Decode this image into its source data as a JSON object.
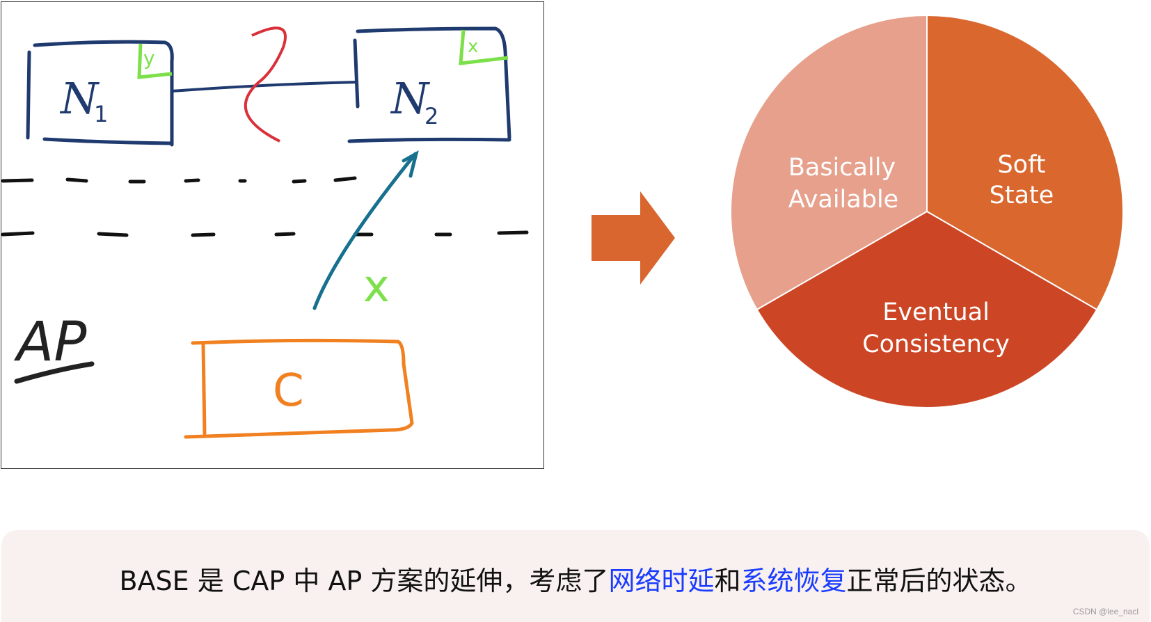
{
  "sketch": {
    "node1_label": "N",
    "node1_sub": "1",
    "node1_tag": "y",
    "node2_label": "N",
    "node2_sub": "2",
    "node2_tag": "x",
    "client_label": "C",
    "mode_label": "AP",
    "write_label": "x",
    "colors": {
      "node": "#1f3a6e",
      "partition": "#d9303a",
      "tag": "#7de04a",
      "client": "#f08020",
      "arrow": "#17708e",
      "ink": "#222222"
    }
  },
  "transition_arrow": {
    "color": "#d9662e"
  },
  "base_pie": {
    "segments": [
      {
        "label_line1": "Basically",
        "label_line2": "Available",
        "color": "#e6a08c"
      },
      {
        "label_line1": "Soft",
        "label_line2": "State",
        "color": "#d9672e"
      },
      {
        "label_line1": "Eventual",
        "label_line2": "Consistency",
        "color": "#cc4626"
      }
    ]
  },
  "caption": {
    "part1": "BASE 是 CAP 中 AP 方案的延伸，考虑了",
    "highlight1": "网络时延",
    "part2": "和",
    "highlight2": "系统恢复",
    "part3": "正常后的状态。",
    "highlight_color": "#1a3cff"
  },
  "watermark": "CSDN @lee_nacl"
}
